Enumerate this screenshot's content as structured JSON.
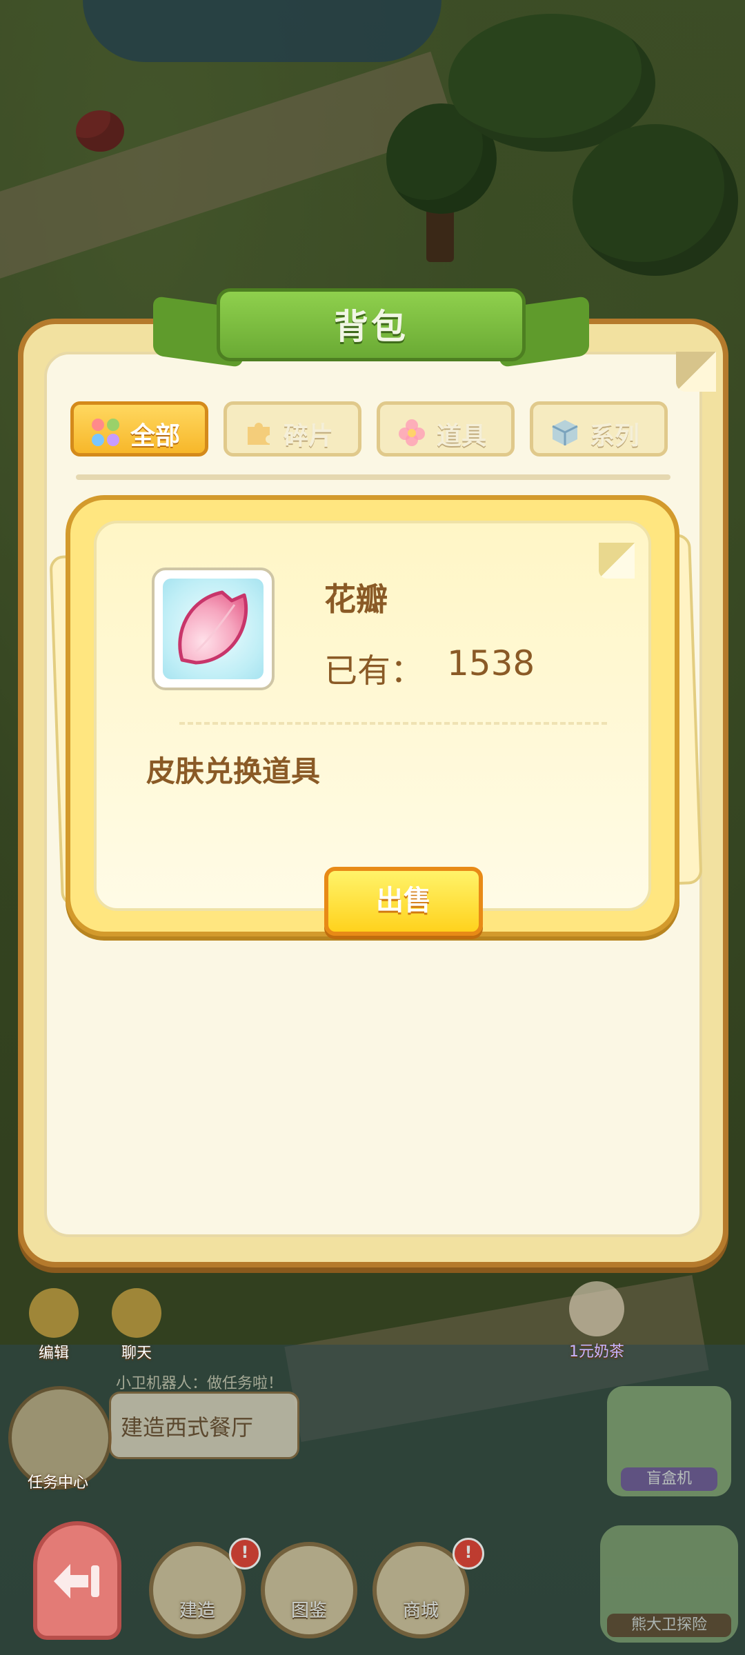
{
  "bag": {
    "title": "背包",
    "tabs": [
      {
        "label": "全部",
        "icon": "grid-icon",
        "active": true
      },
      {
        "label": "碎片",
        "icon": "puzzle-icon",
        "active": false
      },
      {
        "label": "道具",
        "icon": "flower-icon",
        "active": false
      },
      {
        "label": "系列",
        "icon": "box-icon",
        "active": false
      }
    ]
  },
  "detail": {
    "item_name": "花瓣",
    "owned_label": "已有：",
    "owned_count": "1538",
    "description": "皮肤兑换道具",
    "sell_label": "出售",
    "item_icon": "petal-icon"
  },
  "hud": {
    "edit_label": "编辑",
    "chat_label": "聊天",
    "robot_speaker": "小卫机器人：做任务啦！",
    "task_text": "建造西式餐厅",
    "task_center_label": "任务中心",
    "milk_tea_label": "1元奶茶",
    "blind_box_label": "盲盒机",
    "build_label": "建造",
    "atlas_label": "图鉴",
    "shop_label": "商城",
    "expedition_label": "熊大卫探险",
    "badge_mark": "!"
  },
  "colors": {
    "panel_border": "#b57a2c",
    "ribbon_green": "#6aaa34",
    "active_tab": "#f7b72a",
    "sell_button": "#ffd21d",
    "text_brown": "#8a5a26"
  }
}
